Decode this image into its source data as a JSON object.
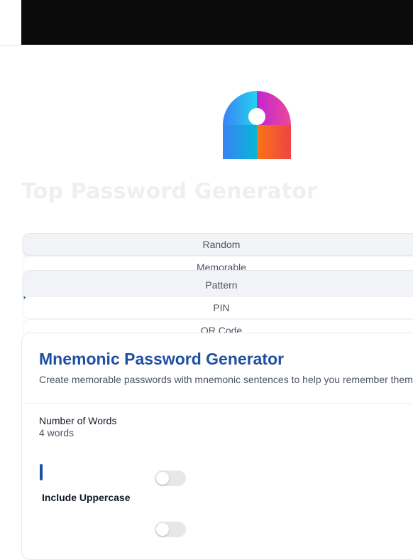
{
  "header": {
    "logo_icon": "password-lock-icon"
  },
  "hero": {
    "title": "Top Password Generator"
  },
  "tabs": [
    {
      "label": "Random"
    },
    {
      "label": "Memorable"
    },
    {
      "label": "Pattern"
    },
    {
      "label": "PIN"
    },
    {
      "label": "QR Code"
    }
  ],
  "active_tab": "Pattern",
  "card": {
    "title": "Mnemonic Password Generator",
    "description": "Create memorable passwords with mnemonic sentences to help you remember them"
  },
  "settings": {
    "words_label": "Number of Words",
    "words_value": "4 words",
    "words_fraction": 0.0,
    "uppercase_label": "Include Uppercase",
    "uppercase_on": false,
    "second_toggle_on": false
  },
  "colors": {
    "accent": "#1e4fa3",
    "topbar": "#0b0b0b",
    "toggle_off": "#e5e7eb"
  }
}
